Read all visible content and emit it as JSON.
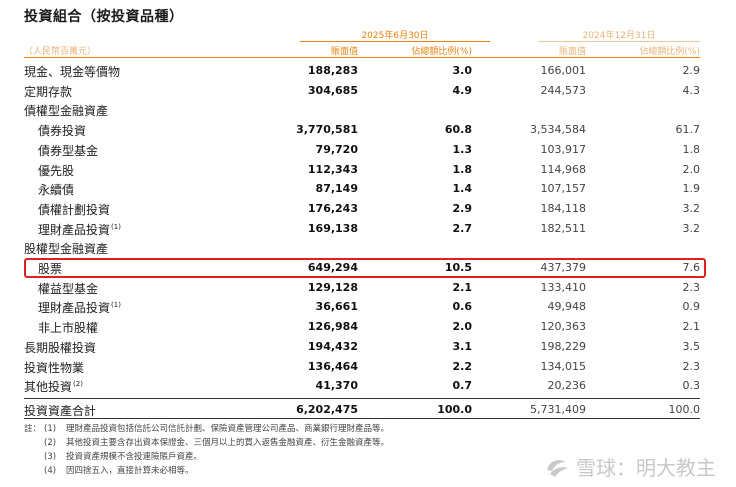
{
  "title": "投資組合（按投資品種）",
  "periods": {
    "current": "2025年6月30日",
    "prior": "2024年12月31日"
  },
  "unit_label": "（人民幣百萬元）",
  "col_headers": {
    "c1": "賬面值",
    "c2": "佔總額比例(%)",
    "c3": "賬面值",
    "c4": "佔總額比例(%)"
  },
  "rows": [
    {
      "label": "現金、現金等價物",
      "c1": "188,283",
      "c2": "3.0",
      "c3": "166,001",
      "c4": "2.9"
    },
    {
      "label": "定期存款",
      "c1": "304,685",
      "c2": "4.9",
      "c3": "244,573",
      "c4": "4.3"
    },
    {
      "label": "債權型金融資產",
      "c1": "",
      "c2": "",
      "c3": "",
      "c4": ""
    },
    {
      "label": "債券投資",
      "c1": "3,770,581",
      "c2": "60.8",
      "c3": "3,534,584",
      "c4": "61.7"
    },
    {
      "label": "債券型基金",
      "c1": "79,720",
      "c2": "1.3",
      "c3": "103,917",
      "c4": "1.8"
    },
    {
      "label": "優先股",
      "c1": "112,343",
      "c2": "1.8",
      "c3": "114,968",
      "c4": "2.0"
    },
    {
      "label": "永續債",
      "c1": "87,149",
      "c2": "1.4",
      "c3": "107,157",
      "c4": "1.9"
    },
    {
      "label": "債權計劃投資",
      "c1": "176,243",
      "c2": "2.9",
      "c3": "184,118",
      "c4": "3.2"
    },
    {
      "label": "理財產品投資",
      "sup": "(1)",
      "c1": "169,138",
      "c2": "2.7",
      "c3": "182,511",
      "c4": "3.2"
    },
    {
      "label": "股權型金融資產",
      "c1": "",
      "c2": "",
      "c3": "",
      "c4": ""
    },
    {
      "label": "股票",
      "c1": "649,294",
      "c2": "10.5",
      "c3": "437,379",
      "c4": "7.6"
    },
    {
      "label": "權益型基金",
      "c1": "129,128",
      "c2": "2.1",
      "c3": "133,410",
      "c4": "2.3"
    },
    {
      "label": "理財產品投資",
      "sup": "(1)",
      "c1": "36,661",
      "c2": "0.6",
      "c3": "49,948",
      "c4": "0.9"
    },
    {
      "label": "非上市股權",
      "c1": "126,984",
      "c2": "2.0",
      "c3": "120,363",
      "c4": "2.1"
    },
    {
      "label": "長期股權投資",
      "c1": "194,432",
      "c2": "3.1",
      "c3": "198,229",
      "c4": "3.5"
    },
    {
      "label": "投資性物業",
      "c1": "136,464",
      "c2": "2.2",
      "c3": "134,015",
      "c4": "2.3"
    },
    {
      "label": "其他投資",
      "sup": "(2)",
      "c1": "41,370",
      "c2": "0.7",
      "c3": "20,236",
      "c4": "0.3"
    }
  ],
  "total": {
    "label": "投資資產合計",
    "c1": "6,202,475",
    "c2": "100.0",
    "c3": "5,731,409",
    "c4": "100.0"
  },
  "notes_prefix": "註：",
  "notes": [
    {
      "num": "(1)",
      "text": "理財產品投資包括信託公司信託計劃、保險資產管理公司產品、商業銀行理財產品等。"
    },
    {
      "num": "(2)",
      "text": "其他投資主要含存出資本保證金、三個月以上的買入返售金融資產、衍生金融資產等。"
    },
    {
      "num": "(3)",
      "text": "投資資產規模不含投連險賬戶資產。"
    },
    {
      "num": "(4)",
      "text": "因四捨五入，直接計算未必相等。"
    }
  ],
  "watermark": "雪球：明大教主",
  "colors": {
    "accent": "#e8830e",
    "accent_light": "#e8b27a",
    "highlight_border": "#e02020"
  }
}
